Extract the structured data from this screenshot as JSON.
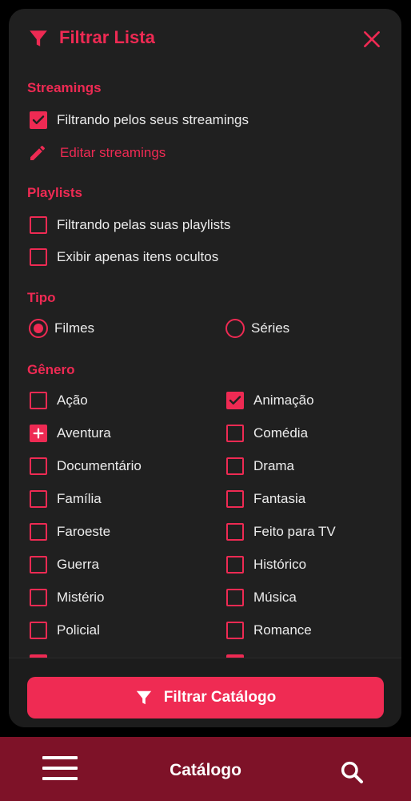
{
  "dialog": {
    "title": "Filtrar Lista",
    "icons": {
      "title": "funnel-icon",
      "close": "close-icon"
    }
  },
  "sections": {
    "streamings": {
      "title": "Streamings",
      "filter_own_label": "Filtrando pelos seus streamings",
      "filter_own_checked": true,
      "edit_label": "Editar streamings",
      "edit_icon": "pencil-icon"
    },
    "playlists": {
      "title": "Playlists",
      "items": [
        {
          "label": "Filtrando pelas suas playlists",
          "checked": false
        },
        {
          "label": "Exibir apenas itens ocultos",
          "checked": false
        }
      ]
    },
    "tipo": {
      "title": "Tipo",
      "options": [
        {
          "label": "Filmes",
          "selected": true
        },
        {
          "label": "Séries",
          "selected": false
        }
      ]
    },
    "genero": {
      "title": "Gênero",
      "items": [
        {
          "label": "Ação",
          "state": "unchecked"
        },
        {
          "label": "Animação",
          "state": "checked"
        },
        {
          "label": "Aventura",
          "state": "plus"
        },
        {
          "label": "Comédia",
          "state": "unchecked"
        },
        {
          "label": "Documentário",
          "state": "unchecked"
        },
        {
          "label": "Drama",
          "state": "unchecked"
        },
        {
          "label": "Família",
          "state": "unchecked"
        },
        {
          "label": "Fantasia",
          "state": "unchecked"
        },
        {
          "label": "Faroeste",
          "state": "unchecked"
        },
        {
          "label": "Feito para TV",
          "state": "unchecked"
        },
        {
          "label": "Guerra",
          "state": "unchecked"
        },
        {
          "label": "Histórico",
          "state": "unchecked"
        },
        {
          "label": "Mistério",
          "state": "unchecked"
        },
        {
          "label": "Música",
          "state": "unchecked"
        },
        {
          "label": "Policial",
          "state": "unchecked"
        },
        {
          "label": "Romance",
          "state": "unchecked"
        }
      ]
    }
  },
  "footer": {
    "button_label": "Filtrar Catálogo",
    "button_icon": "funnel-icon"
  },
  "bottom_nav": {
    "title": "Catálogo",
    "menu_icon": "hamburger-menu-icon",
    "search_icon": "search-icon"
  },
  "colors": {
    "accent": "#ee2a53",
    "panel": "#202020",
    "bottom_bar": "#7e1228",
    "text": "#ececec"
  }
}
